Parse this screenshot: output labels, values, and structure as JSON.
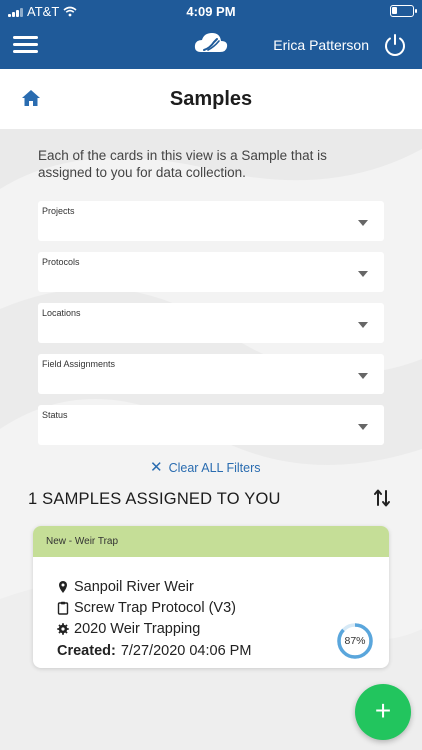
{
  "status": {
    "carrier": "AT&T",
    "time": "4:09 PM"
  },
  "header": {
    "user_name": "Erica Patterson"
  },
  "page": {
    "title": "Samples",
    "description": "Each of the cards in this view is a Sample that is assigned to you for data collection."
  },
  "filters": {
    "projects": "Projects",
    "protocols": "Protocols",
    "locations": "Locations",
    "field_assignments": "Field Assignments",
    "status": "Status"
  },
  "clear_filters_label": "Clear ALL Filters",
  "samples_count_label": "1 SAMPLES ASSIGNED TO YOU",
  "sample_card": {
    "status": "New - Weir Trap",
    "location": "Sanpoil River Weir",
    "protocol": "Screw Trap Protocol (V3)",
    "project": "2020 Weir Trapping",
    "created_label": "Created:",
    "created_value": "7/27/2020 04:06 PM",
    "progress_label": "87%",
    "progress_fraction": 0.87
  },
  "colors": {
    "header_bg": "#1f5a99",
    "card_band": "#c5de97",
    "accent_link": "#2a6cb0",
    "fab": "#22c55e",
    "progress_ring": "#5aa6dc"
  }
}
